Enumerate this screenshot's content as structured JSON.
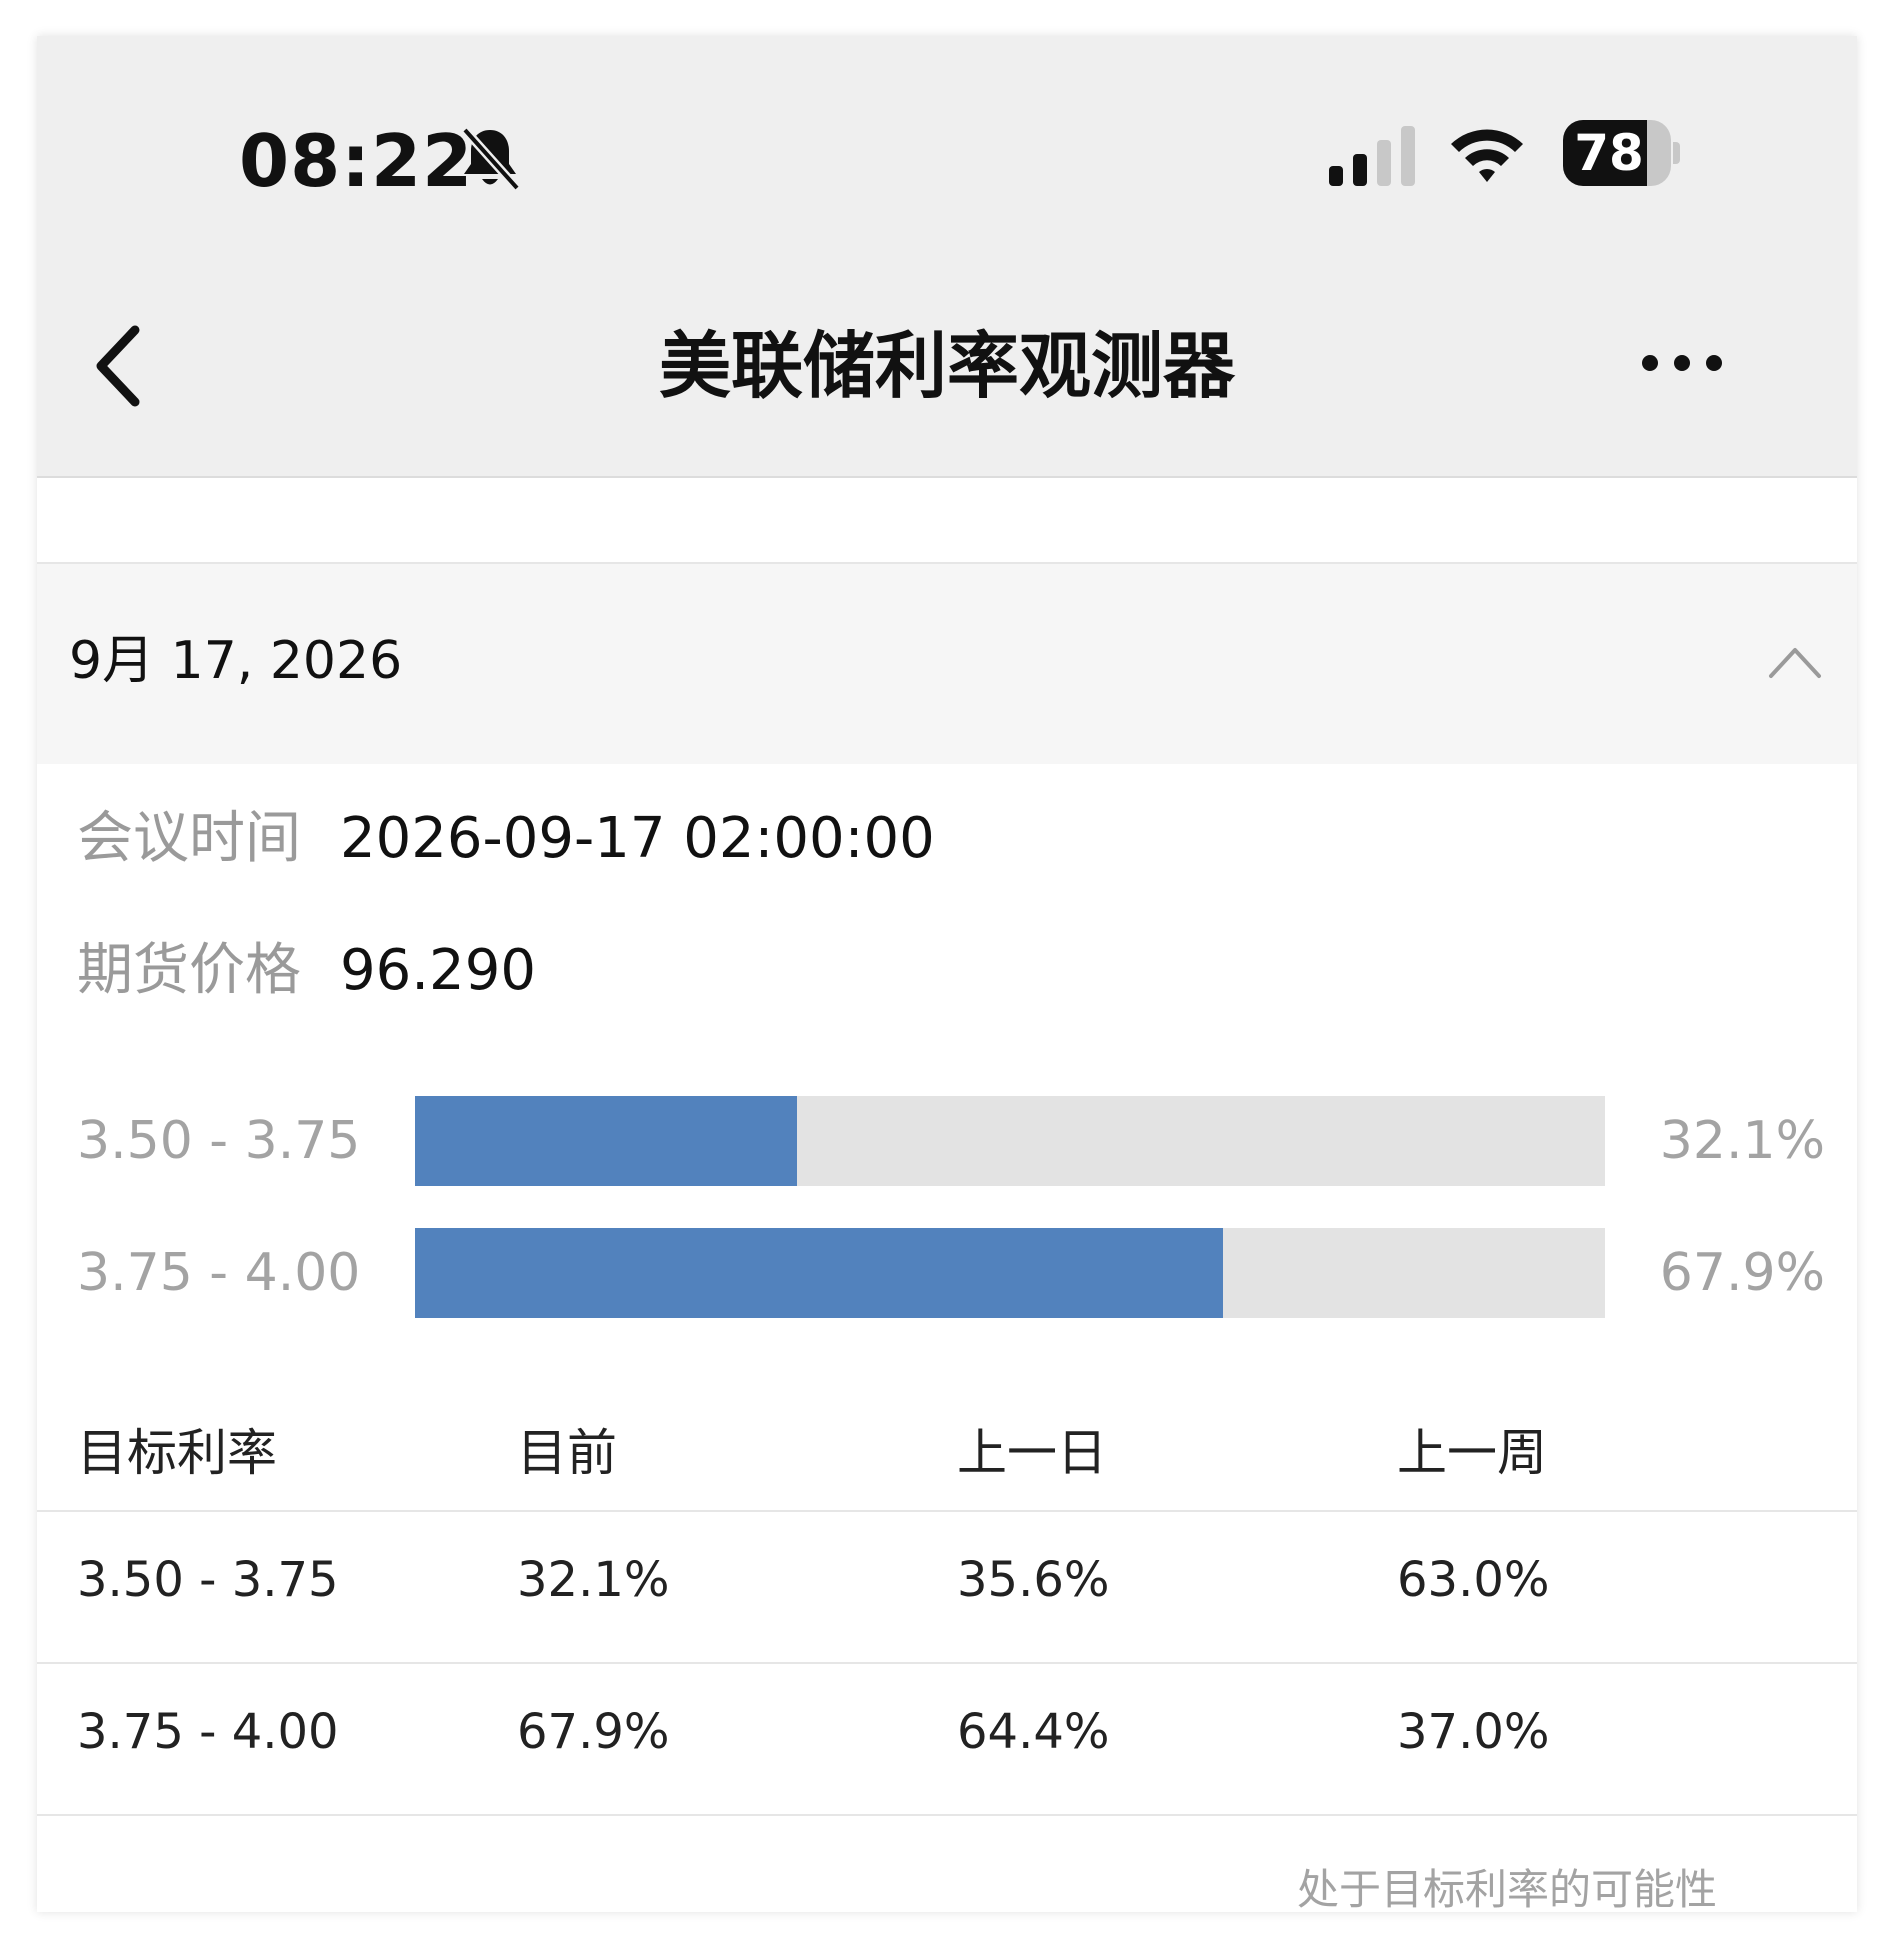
{
  "status_bar": {
    "time": "08:22",
    "battery_level": "78"
  },
  "nav": {
    "title": "美联储利率观测器"
  },
  "section": {
    "date": "9月 17, 2026"
  },
  "info": {
    "meeting_time_label": "会议时间",
    "meeting_time_value": "2026-09-17 02:00:00",
    "futures_price_label": "期货价格",
    "futures_price_value": "96.290"
  },
  "probability_bars": [
    {
      "range": "3.50 - 3.75",
      "percent_text": "32.1%",
      "value": 32.1
    },
    {
      "range": "3.75 - 4.00",
      "percent_text": "67.9%",
      "value": 67.9
    }
  ],
  "table": {
    "headers": [
      "目标利率",
      "目前",
      "上一日",
      "上一周"
    ],
    "rows": [
      [
        "3.50 - 3.75",
        "32.1%",
        "35.6%",
        "63.0%"
      ],
      [
        "3.75 - 4.00",
        "67.9%",
        "64.4%",
        "37.0%"
      ]
    ]
  },
  "footer": {
    "note": "处于目标利率的可能性"
  },
  "colors": {
    "bar_fill": "#5282bd",
    "bar_track": "#e3e3e3",
    "header_bg": "#efefef"
  }
}
